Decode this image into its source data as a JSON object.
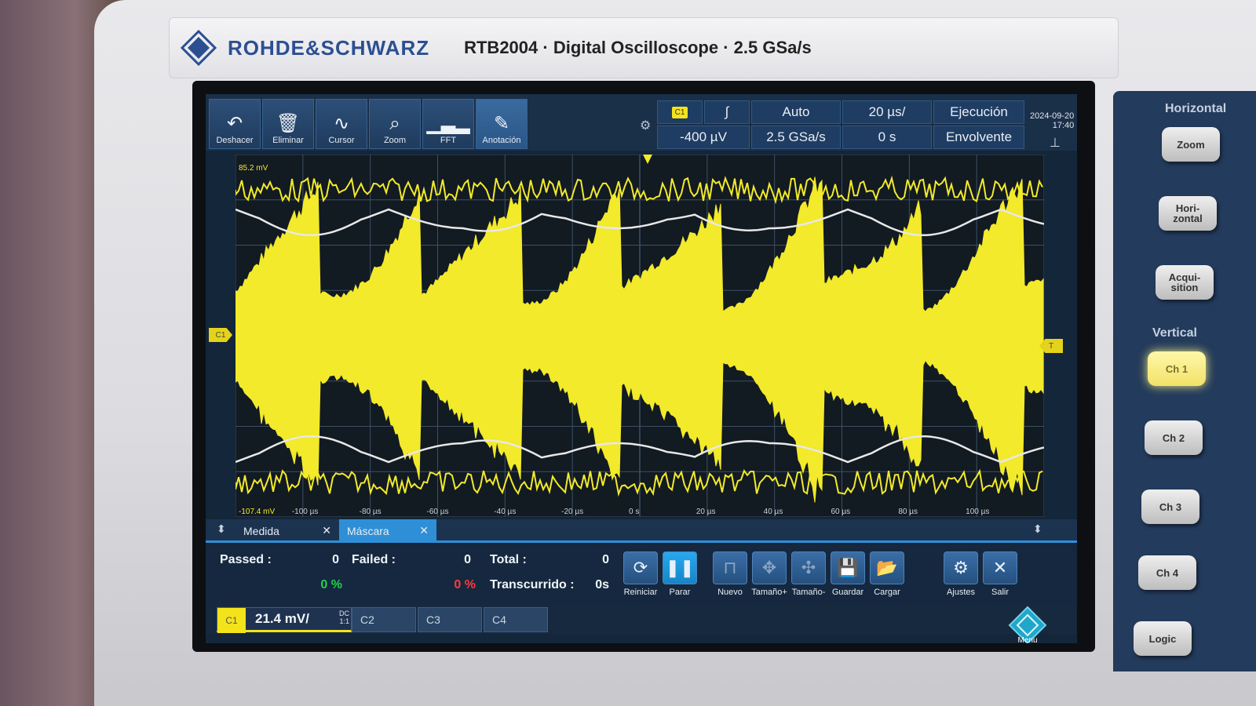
{
  "header": {
    "brand": "ROHDE&SCHWARZ",
    "model": "RTB2004 · Digital Oscilloscope · 2.5 GSa/s"
  },
  "toolbar": {
    "items": [
      {
        "label": "Deshacer",
        "icon": "undo-icon"
      },
      {
        "label": "Eliminar",
        "icon": "trash-icon"
      },
      {
        "label": "Cursor",
        "icon": "cursor-wave-icon"
      },
      {
        "label": "Zoom",
        "icon": "magnifier-icon"
      },
      {
        "label": "FFT",
        "icon": "spectrum-icon"
      },
      {
        "label": "Anotación",
        "icon": "pencil-icon"
      }
    ]
  },
  "trigger": {
    "source": "C1",
    "mode": "Auto",
    "level": "-400 µV",
    "sample_rate": "2.5 GSa/s",
    "timebase": "20 µs/",
    "position": "0 s",
    "run_state": "Ejecución",
    "acq_mode": "Envolvente"
  },
  "datetime": {
    "date": "2024-09-20",
    "time": "17:40"
  },
  "plot": {
    "y_top_label": "85.2 mV",
    "y_bottom_label": "-107.4 mV",
    "x_ticks": [
      "-100 µs",
      "-80 µs",
      "-60 µs",
      "-40 µs",
      "-20 µs",
      "0 s",
      "20 µs",
      "40 µs",
      "60 µs",
      "80 µs",
      "100 µs"
    ],
    "trace_color": "#f2ea2a",
    "mask_color": "#e8e8e8",
    "grid_color": "#3d5064",
    "channel_marker": "C1"
  },
  "tabs": {
    "measure": "Medida",
    "mask": "Máscara"
  },
  "mask_panel": {
    "passed_label": "Passed :",
    "passed_value": "0",
    "passed_pct": "0 %",
    "failed_label": "Failed :",
    "failed_value": "0",
    "failed_pct": "0 %",
    "total_label": "Total :",
    "total_value": "0",
    "elapsed_label": "Transcurrido :",
    "elapsed_value": "0s",
    "buttons": [
      "Reiniciar",
      "Parar",
      "Nuevo",
      "Tamaño+",
      "Tamaño-",
      "Guardar",
      "Cargar",
      "Ajustes",
      "Salir"
    ]
  },
  "channels": {
    "c1_label": "C1",
    "c1_scale": "21.4 mV/",
    "c1_coupling": "DC",
    "c1_probe": "1:1",
    "c2_label": "C2",
    "c3_label": "C3",
    "c4_label": "C4",
    "menu_label": "Menu"
  },
  "side": {
    "horizontal_title": "Horizontal",
    "zoom": "Zoom",
    "horizontal_btn": "Hori-\nzontal",
    "acquisition_btn": "Acqui-\nsition",
    "vertical_title": "Vertical",
    "ch1": "Ch 1",
    "ch2": "Ch 2",
    "ch3": "Ch 3",
    "ch4": "Ch 4",
    "logic": "Logic"
  }
}
